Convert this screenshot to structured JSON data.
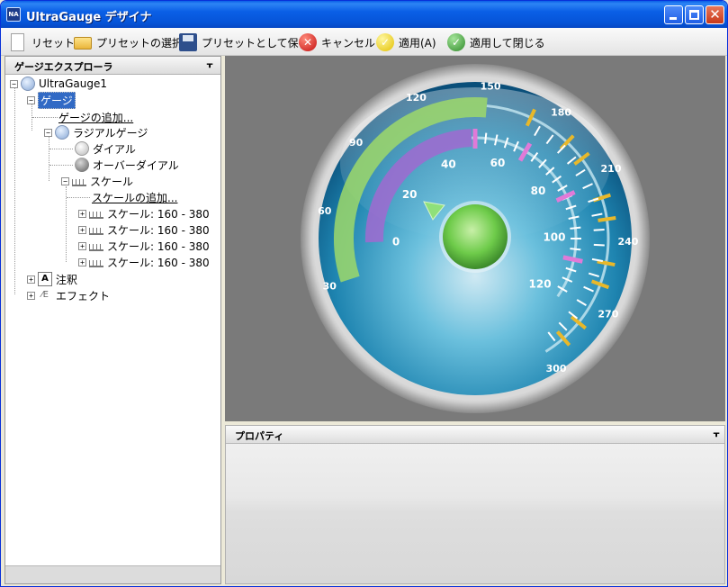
{
  "window": {
    "title": "UltraGauge デザイナ",
    "app_icon_text": "NA"
  },
  "toolbar": {
    "reset": "リセット",
    "preset_select": "プリセットの選択",
    "save_preset": "プリセットとして保存",
    "cancel": "キャンセル",
    "apply": "適用(A)",
    "apply_close": "適用して閉じる"
  },
  "explorer": {
    "title": "ゲージエクスプローラ",
    "root": "UltraGauge1",
    "gauges": "ゲージ",
    "add_gauge": "ゲージの追加...",
    "radial_gauge": "ラジアルゲージ",
    "dial": "ダイアル",
    "over_dial": "オーバーダイアル",
    "scales": "スケール",
    "add_scale": "スケールの追加...",
    "scale_items": [
      "スケール: 160 - 380",
      "スケール: 160 - 380",
      "スケール: 160 - 380",
      "スケール: 160 - 380"
    ],
    "annotations": "注釈",
    "effects": "エフェクト"
  },
  "properties": {
    "title": "プロパティ"
  },
  "gauge": {
    "outer_labels": [
      "30",
      "60",
      "90",
      "120",
      "150",
      "180",
      "210",
      "240",
      "270",
      "300"
    ],
    "inner_labels": [
      "0",
      "20",
      "40",
      "60",
      "80",
      "100",
      "120"
    ],
    "colors": {
      "green_band": "#9ed86a",
      "purple_band": "#a06ad0",
      "pink_marker": "#e07ad8",
      "orange_marker": "#e8b82a",
      "face": "#2a8fb8"
    }
  }
}
